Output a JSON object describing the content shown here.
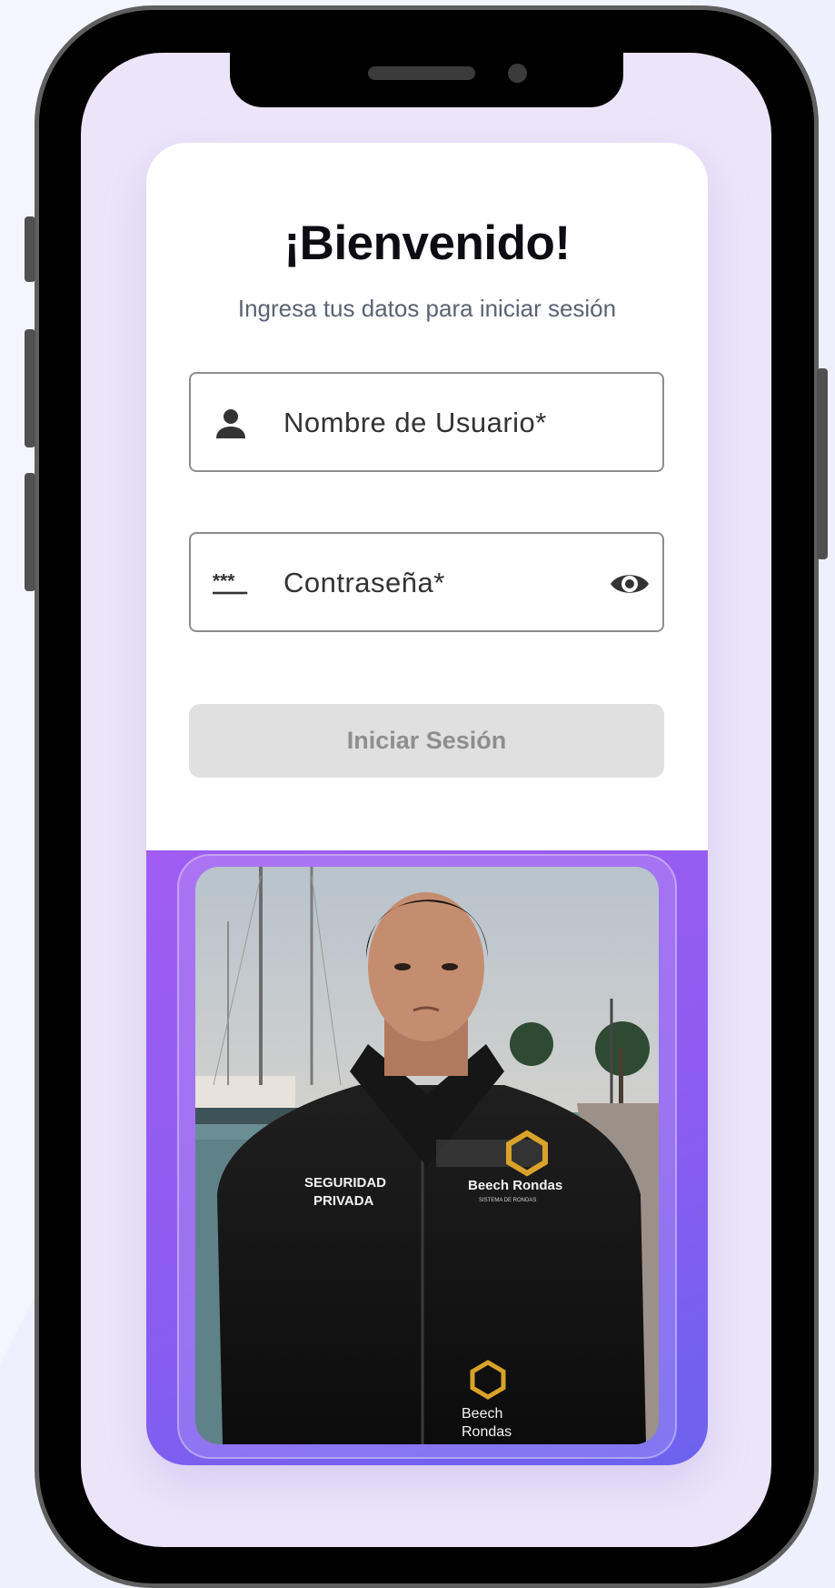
{
  "login": {
    "title": "¡Bienvenido!",
    "subtitle": "Ingresa tus datos para iniciar sesión",
    "username_label": "Nombre de Usuario*",
    "password_label": "Contraseña*",
    "password_mask_icon": "***",
    "submit_label": "Iniciar Sesión"
  },
  "photo": {
    "jacket_left_text_1": "SEGURIDAD",
    "jacket_left_text_2": "PRIVADA",
    "jacket_brand": "Beech Rondas",
    "jacket_tagline": "SISTEMA DE RONDAS",
    "jacket_bottom_1": "Beech",
    "jacket_bottom_2": "Rondas"
  },
  "icons": {
    "username": "person-icon",
    "password": "password-icon",
    "toggle": "eye-icon"
  },
  "colors": {
    "accent_start": "#a05cf3",
    "accent_end": "#6b62ee",
    "screen_bg": "#ece5fa",
    "button_disabled_bg": "#e0e0e0",
    "button_disabled_text": "#8e8e8e"
  }
}
